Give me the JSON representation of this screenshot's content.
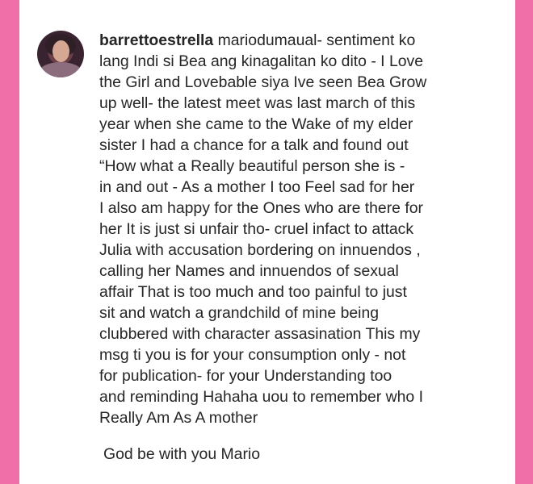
{
  "comment": {
    "username": "barrettoestrella",
    "lines": [
      "mariodumaual- sentiment ko",
      "lang  Indi si Bea ang kinagalitan ko dito - I Love",
      "the Girl and Lovebable siya  Ive seen Bea Grow",
      "up well- the latest meet was last march of this",
      "year when she came to the Wake of my elder",
      "sister  I had a chance for a talk and found out",
      "“How what a Really  beautiful person she is -",
      "in and out -  As a mother I too Feel sad for her",
      "I also am happy for the Ones who are there for",
      "her  It is just si unfair tho- cruel infact to attack",
      "Julia with accusation bordering on innuendos ,",
      "calling her Names and innuendos of sexual",
      "affair  That is too much and too painful to just",
      "sit and watch a grandchild of mine being",
      "clubbered with character assasination  This my",
      "msg ti you is for your consumption only - not",
      "for publication- for your Understanding too",
      "and reminding Hahaha uou to remember who I",
      "Really Am As A mother"
    ],
    "signoff": "God be with you Mario"
  },
  "colors": {
    "border": "#f06fa8",
    "background": "#ffffff",
    "text": "#262626"
  }
}
